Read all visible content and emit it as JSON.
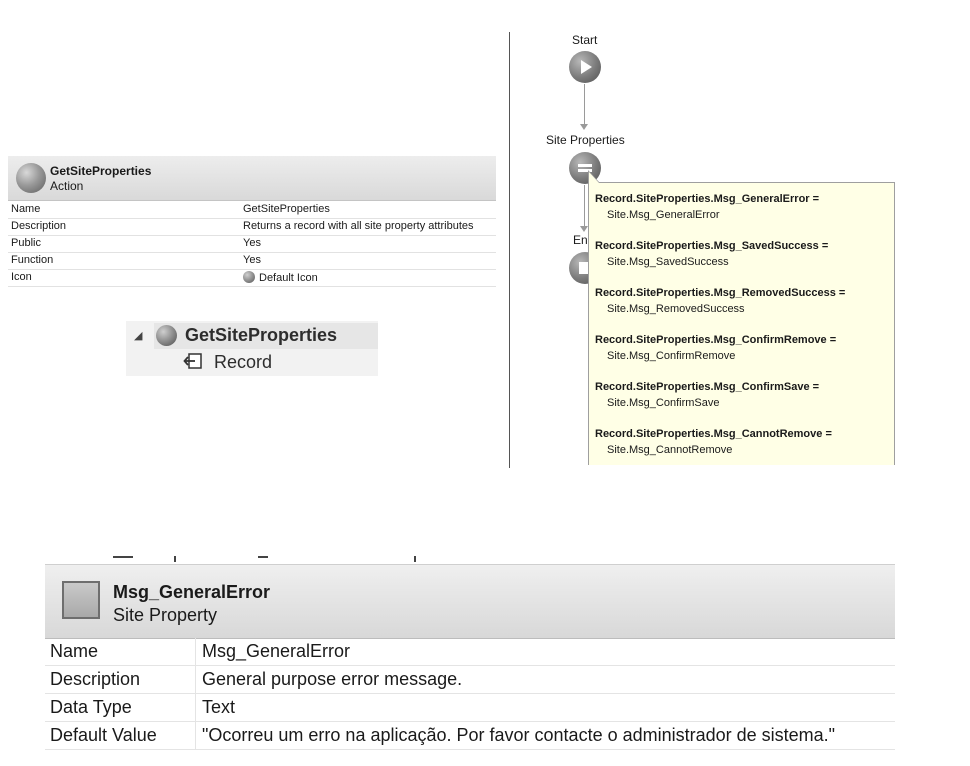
{
  "action_panel": {
    "title": "GetSiteProperties",
    "subtitle": "Action",
    "rows": [
      {
        "key": "Name",
        "value": "GetSiteProperties"
      },
      {
        "key": "Description",
        "value": "Returns a record with all site property attributes"
      },
      {
        "key": "Public",
        "value": "Yes"
      },
      {
        "key": "Function",
        "value": "Yes"
      },
      {
        "key": "Icon",
        "value": "Default Icon"
      }
    ]
  },
  "tree": {
    "node_label": "GetSiteProperties",
    "child_label": "Record"
  },
  "flow": {
    "start_label": "Start",
    "assign_label": "Site Properties",
    "end_label": "End",
    "assignments": [
      {
        "lhs": "Record.SiteProperties.Msg_GeneralError =",
        "rhs": "Site.Msg_GeneralError"
      },
      {
        "lhs": "Record.SiteProperties.Msg_SavedSuccess =",
        "rhs": "Site.Msg_SavedSuccess"
      },
      {
        "lhs": "Record.SiteProperties.Msg_RemovedSuccess =",
        "rhs": "Site.Msg_RemovedSuccess"
      },
      {
        "lhs": "Record.SiteProperties.Msg_ConfirmRemove =",
        "rhs": "Site.Msg_ConfirmRemove"
      },
      {
        "lhs": "Record.SiteProperties.Msg_ConfirmSave =",
        "rhs": "Site.Msg_ConfirmSave"
      },
      {
        "lhs": "Record.SiteProperties.Msg_CannotRemove =",
        "rhs": "Site.Msg_CannotRemove"
      }
    ]
  },
  "site_property_panel": {
    "title": "Msg_GeneralError",
    "subtitle": "Site Property",
    "rows": [
      {
        "key": "Name",
        "value": "Msg_GeneralError"
      },
      {
        "key": "Description",
        "value": "General purpose error message."
      },
      {
        "key": "Data Type",
        "value": "Text"
      },
      {
        "key": "Default Value",
        "value": "\"Ocorreu um erro na aplicação. Por favor contacte o administrador de sistema.\""
      }
    ]
  }
}
